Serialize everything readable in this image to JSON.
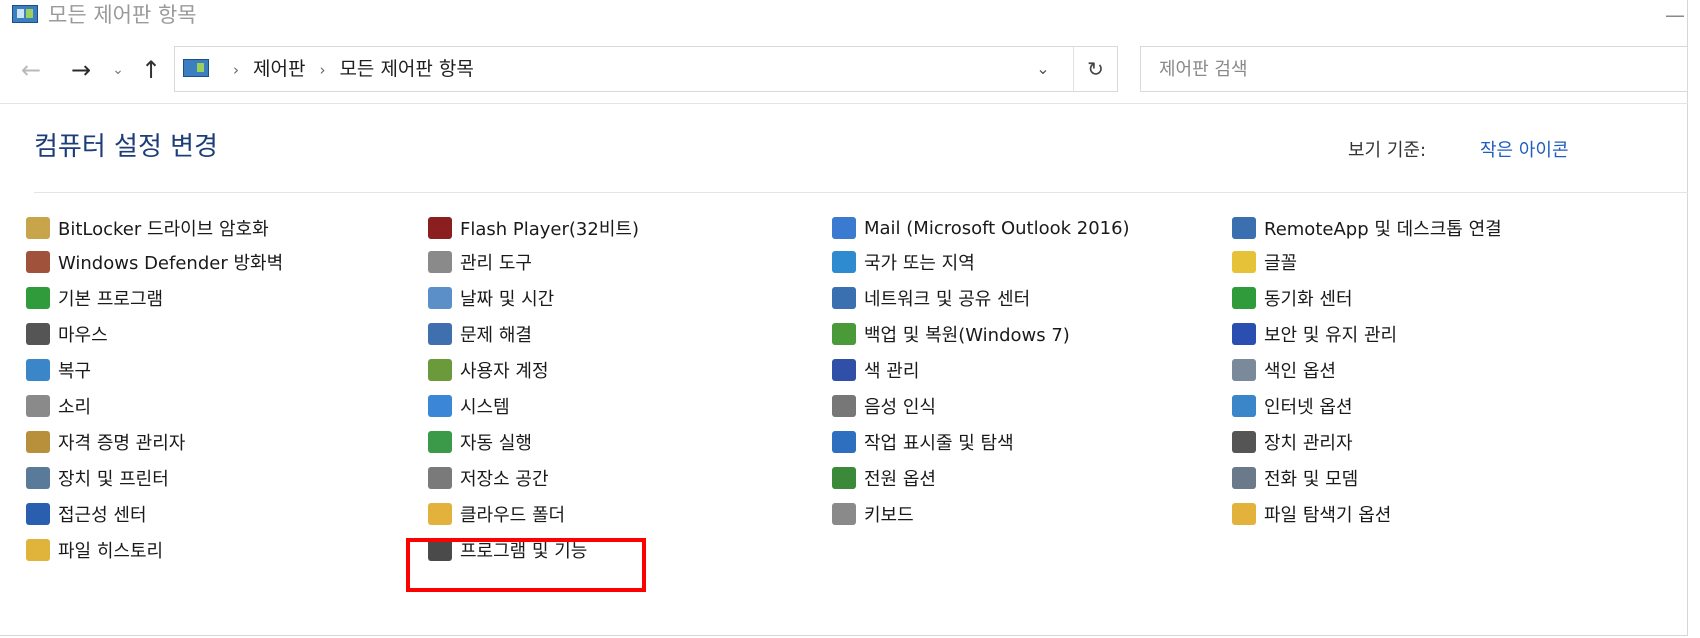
{
  "window": {
    "title": "모든 제어판 항목",
    "minimize_glyph": "—"
  },
  "nav": {
    "back_glyph": "←",
    "forward_glyph": "→",
    "recent_glyph": "⌄",
    "up_glyph": "↑",
    "breadcrumbs": [
      "제어판",
      "모든 제어판 항목"
    ],
    "separator": "›",
    "dropdown_glyph": "⌄",
    "refresh_glyph": "↻",
    "search_placeholder": "제어판 검색"
  },
  "header": {
    "title": "컴퓨터 설정 변경",
    "view_by_label": "보기 기준:",
    "view_by_value": "작은 아이콘"
  },
  "highlight": {
    "target": "프로그램 및 기능"
  },
  "items": [
    {
      "label": "BitLocker 드라이브 암호화",
      "icon": "bitlocker-icon",
      "color": "#c8a44a"
    },
    {
      "label": "Windows Defender 방화벽",
      "icon": "firewall-icon",
      "color": "#a0523a"
    },
    {
      "label": "기본 프로그램",
      "icon": "default-programs-icon",
      "color": "#2f9b3a"
    },
    {
      "label": "마우스",
      "icon": "mouse-icon",
      "color": "#555555"
    },
    {
      "label": "복구",
      "icon": "recovery-icon",
      "color": "#3a86c9"
    },
    {
      "label": "소리",
      "icon": "sound-icon",
      "color": "#8a8a8a"
    },
    {
      "label": "자격 증명 관리자",
      "icon": "credential-manager-icon",
      "color": "#b8903c"
    },
    {
      "label": "장치 및 프린터",
      "icon": "devices-printers-icon",
      "color": "#5a7a99"
    },
    {
      "label": "접근성 센터",
      "icon": "ease-of-access-icon",
      "color": "#2a5fb0"
    },
    {
      "label": "파일 히스토리",
      "icon": "file-history-icon",
      "color": "#e0b43a"
    },
    {
      "label": "Flash Player(32비트)",
      "icon": "flash-player-icon",
      "color": "#8b1e1e"
    },
    {
      "label": "관리 도구",
      "icon": "admin-tools-icon",
      "color": "#8a8a8a"
    },
    {
      "label": "날짜 및 시간",
      "icon": "date-time-icon",
      "color": "#5b8fc7"
    },
    {
      "label": "문제 해결",
      "icon": "troubleshooting-icon",
      "color": "#3f6fae"
    },
    {
      "label": "사용자 계정",
      "icon": "user-accounts-icon",
      "color": "#6a9a3a"
    },
    {
      "label": "시스템",
      "icon": "system-icon",
      "color": "#3b86d6"
    },
    {
      "label": "자동 실행",
      "icon": "autoplay-icon",
      "color": "#3a9a4a"
    },
    {
      "label": "저장소 공간",
      "icon": "storage-spaces-icon",
      "color": "#7a7a7a"
    },
    {
      "label": "클라우드 폴더",
      "icon": "work-folders-icon",
      "color": "#e3b23c"
    },
    {
      "label": "프로그램 및 기능",
      "icon": "programs-features-icon",
      "color": "#4a4a4a"
    },
    {
      "label": "Mail (Microsoft Outlook 2016)",
      "icon": "mail-icon",
      "color": "#3a7ad0"
    },
    {
      "label": "국가 또는 지역",
      "icon": "region-icon",
      "color": "#2f8bd0"
    },
    {
      "label": "네트워크 및 공유 센터",
      "icon": "network-sharing-icon",
      "color": "#3a6fb0"
    },
    {
      "label": "백업 및 복원(Windows 7)",
      "icon": "backup-restore-icon",
      "color": "#4a9a3a"
    },
    {
      "label": "색 관리",
      "icon": "color-management-icon",
      "color": "#3050a8"
    },
    {
      "label": "음성 인식",
      "icon": "speech-recognition-icon",
      "color": "#777777"
    },
    {
      "label": "작업 표시줄 및 탐색",
      "icon": "taskbar-navigation-icon",
      "color": "#2f6fc0"
    },
    {
      "label": "전원 옵션",
      "icon": "power-options-icon",
      "color": "#3a8a3a"
    },
    {
      "label": "키보드",
      "icon": "keyboard-icon",
      "color": "#8a8a8a"
    },
    {
      "label": "RemoteApp 및 데스크톱 연결",
      "icon": "remoteapp-icon",
      "color": "#3a6fb0"
    },
    {
      "label": "글꼴",
      "icon": "fonts-icon",
      "color": "#e6c238"
    },
    {
      "label": "동기화 센터",
      "icon": "sync-center-icon",
      "color": "#2f9b3a"
    },
    {
      "label": "보안 및 유지 관리",
      "icon": "security-maintenance-icon",
      "color": "#2a4fb0"
    },
    {
      "label": "색인 옵션",
      "icon": "indexing-options-icon",
      "color": "#7a8a9a"
    },
    {
      "label": "인터넷 옵션",
      "icon": "internet-options-icon",
      "color": "#3a86c9"
    },
    {
      "label": "장치 관리자",
      "icon": "device-manager-icon",
      "color": "#555555"
    },
    {
      "label": "전화 및 모뎀",
      "icon": "phone-modem-icon",
      "color": "#6a7a8a"
    },
    {
      "label": "파일 탐색기 옵션",
      "icon": "file-explorer-options-icon",
      "color": "#e3b23c"
    }
  ]
}
